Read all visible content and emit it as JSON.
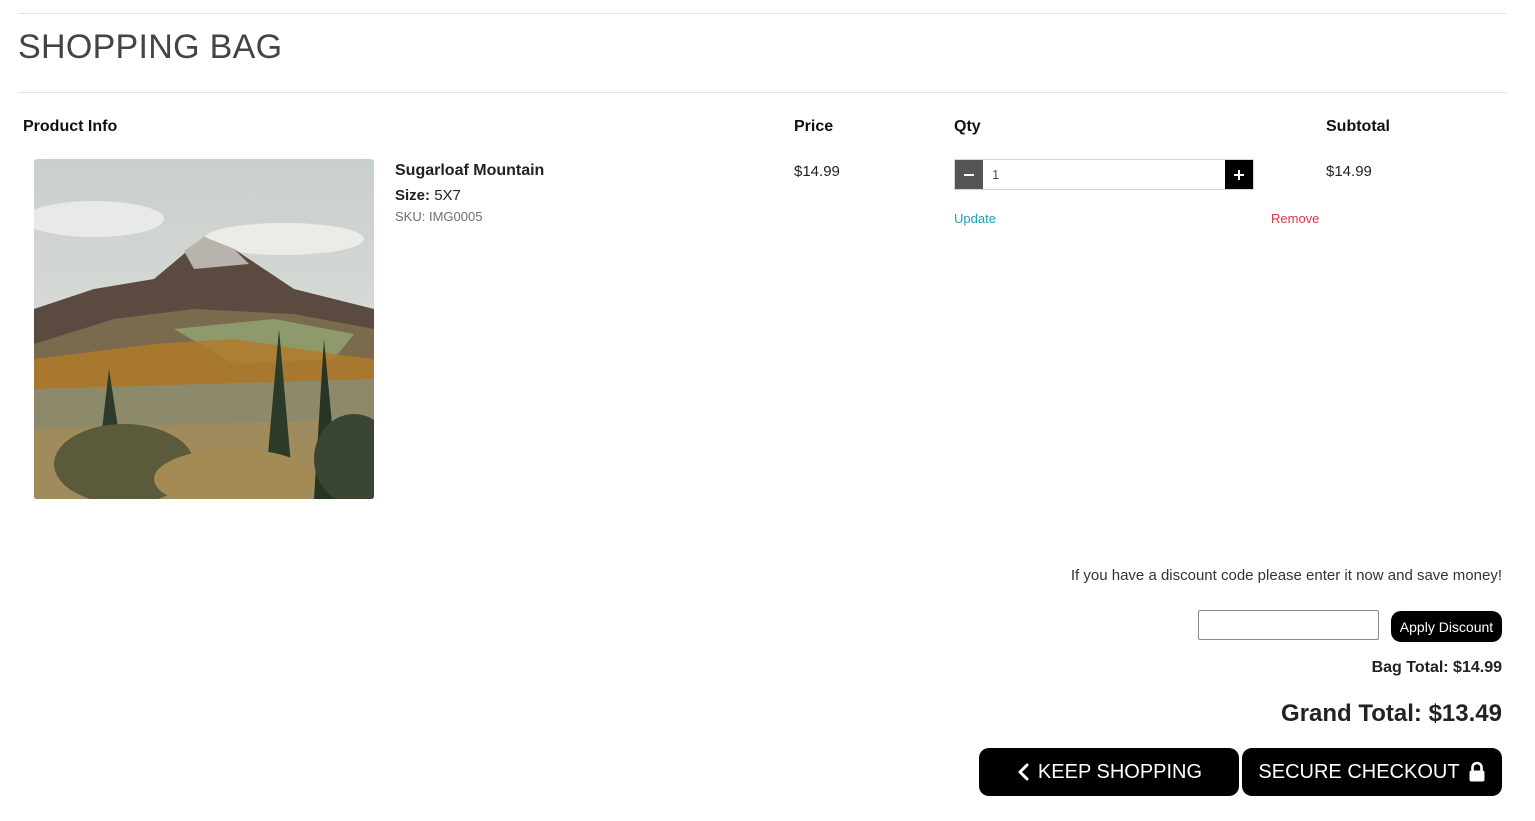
{
  "page": {
    "title": "SHOPPING BAG"
  },
  "table": {
    "headers": {
      "product_info": "Product Info",
      "price": "Price",
      "qty": "Qty",
      "subtotal": "Subtotal"
    }
  },
  "item": {
    "name": "Sugarloaf Mountain",
    "size_label": "Size:",
    "size_value": "5X7",
    "sku": "SKU: IMG0005",
    "price": "$14.99",
    "quantity": "1",
    "subtotal": "$14.99",
    "update_label": "Update",
    "remove_label": "Remove"
  },
  "discount": {
    "message": "If you have a discount code please enter it now and save money!",
    "input_value": "",
    "apply_label": "Apply Discount"
  },
  "totals": {
    "bag_total": "Bag Total: $14.99",
    "grand_total": "Grand Total: $13.49"
  },
  "actions": {
    "keep_shopping": "KEEP SHOPPING",
    "secure_checkout": "SECURE CHECKOUT"
  },
  "icons": {
    "minus": "minus-icon",
    "plus": "plus-icon",
    "back": "chevron-left-icon",
    "lock": "lock-icon"
  },
  "colors": {
    "update_link": "#17a2b8",
    "remove_link": "#dc3545",
    "button_bg": "#000000"
  }
}
